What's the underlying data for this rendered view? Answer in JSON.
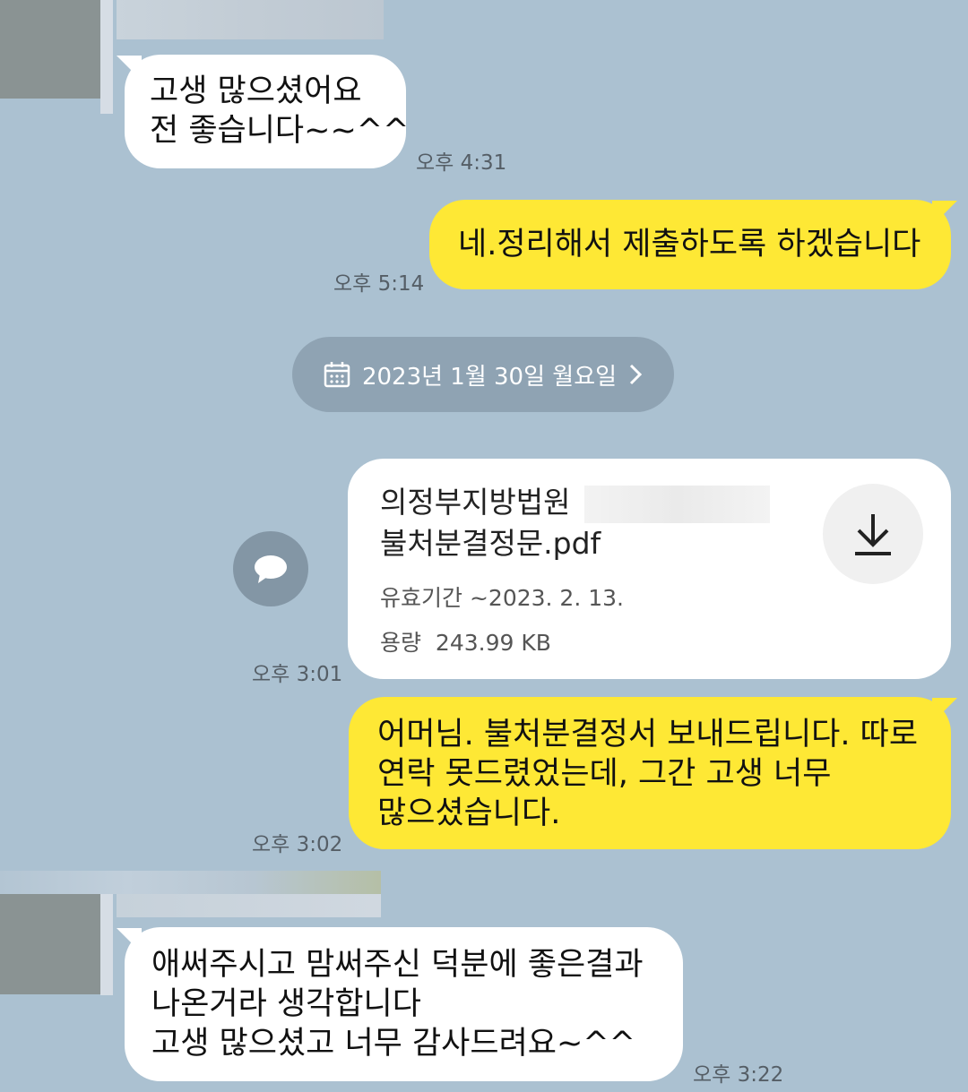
{
  "messages": [
    {
      "lines": [
        "고생 많으셨어요",
        "전 좋습니다~~^^"
      ],
      "time": "오후 4:31"
    },
    {
      "lines": [
        "네.정리해서 제출하도록 하겠습니다"
      ],
      "time": "오후 5:14"
    },
    {
      "lines": [
        "어머님. 불처분결정서 보내드립니다. 따로",
        "연락 못드렸었는데, 그간 고생 너무",
        "많으셨습니다."
      ],
      "time": "오후 3:02"
    },
    {
      "lines": [
        "애써주시고 맘써주신 덕분에 좋은결과",
        "나온거라 생각합니다",
        "고생 많으셨고 너무 감사드려요~^^"
      ],
      "time": "오후 3:22"
    }
  ],
  "date_divider": {
    "label": "2023년 1월 30일 월요일",
    "icon": "calendar-icon",
    "chevron": "chevron-right-icon"
  },
  "file": {
    "name_line1": "의정부지방법원",
    "name_line2": "불처분결정문.pdf",
    "expiry_label": "유효기간",
    "expiry_value": "~2023. 2. 13.",
    "size_label": "용량",
    "size_value": "243.99 KB",
    "time": "오후 3:01",
    "download_icon": "download-icon",
    "share_icon": "chat-share-icon"
  },
  "colors": {
    "background": "#abc1d1",
    "outgoing": "#fee835",
    "incoming": "#ffffff"
  }
}
